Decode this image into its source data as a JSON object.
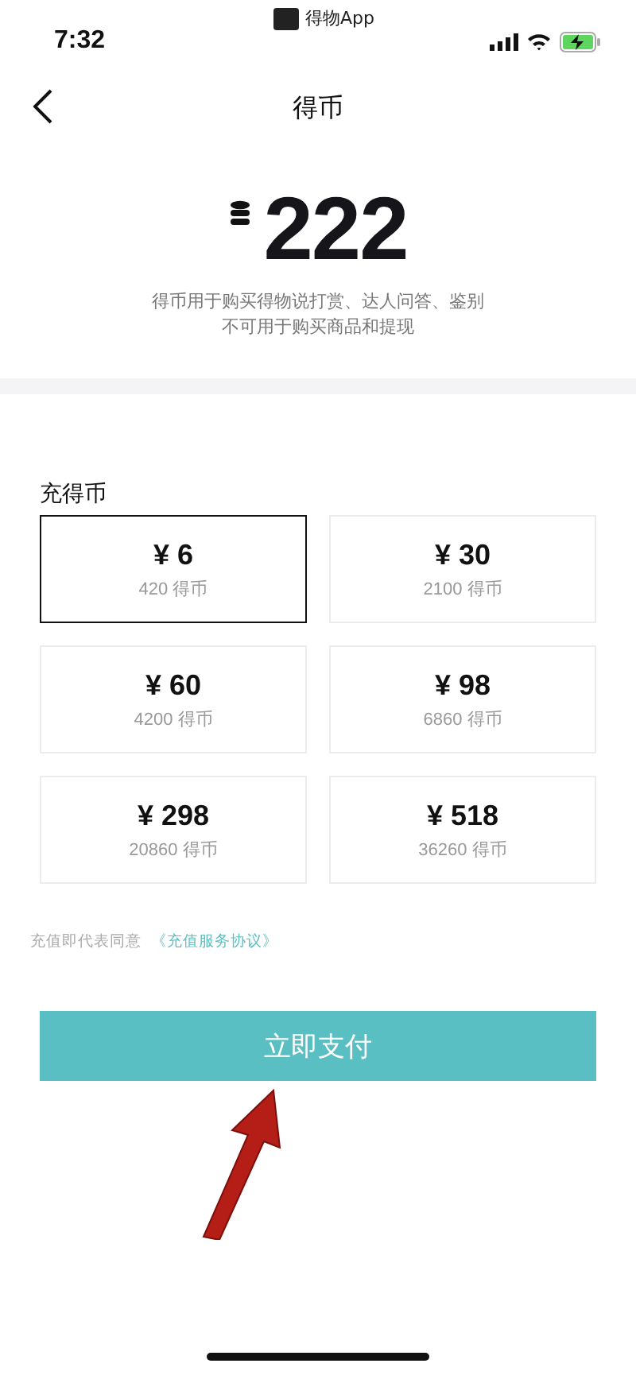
{
  "status_bar": {
    "time": "7:32",
    "app_label": "得物App"
  },
  "nav": {
    "title": "得币"
  },
  "balance": {
    "amount": "222",
    "note_lines": [
      "得币用于购买得物说打赏、达人问答、鉴别",
      "不可用于购买商品和提现"
    ]
  },
  "recharge": {
    "title": "充得币",
    "options": [
      {
        "price": "¥ 6",
        "coins": "420 得币",
        "selected": true
      },
      {
        "price": "¥ 30",
        "coins": "2100 得币",
        "selected": false
      },
      {
        "price": "¥ 60",
        "coins": "4200 得币",
        "selected": false
      },
      {
        "price": "¥ 98",
        "coins": "6860 得币",
        "selected": false
      },
      {
        "price": "¥ 298",
        "coins": "20860 得币",
        "selected": false
      },
      {
        "price": "¥ 518",
        "coins": "36260 得币",
        "selected": false
      }
    ]
  },
  "agreement": {
    "text": "充值即代表同意",
    "link": "《充值服务协议》"
  },
  "pay_button": {
    "label": "立即支付"
  }
}
